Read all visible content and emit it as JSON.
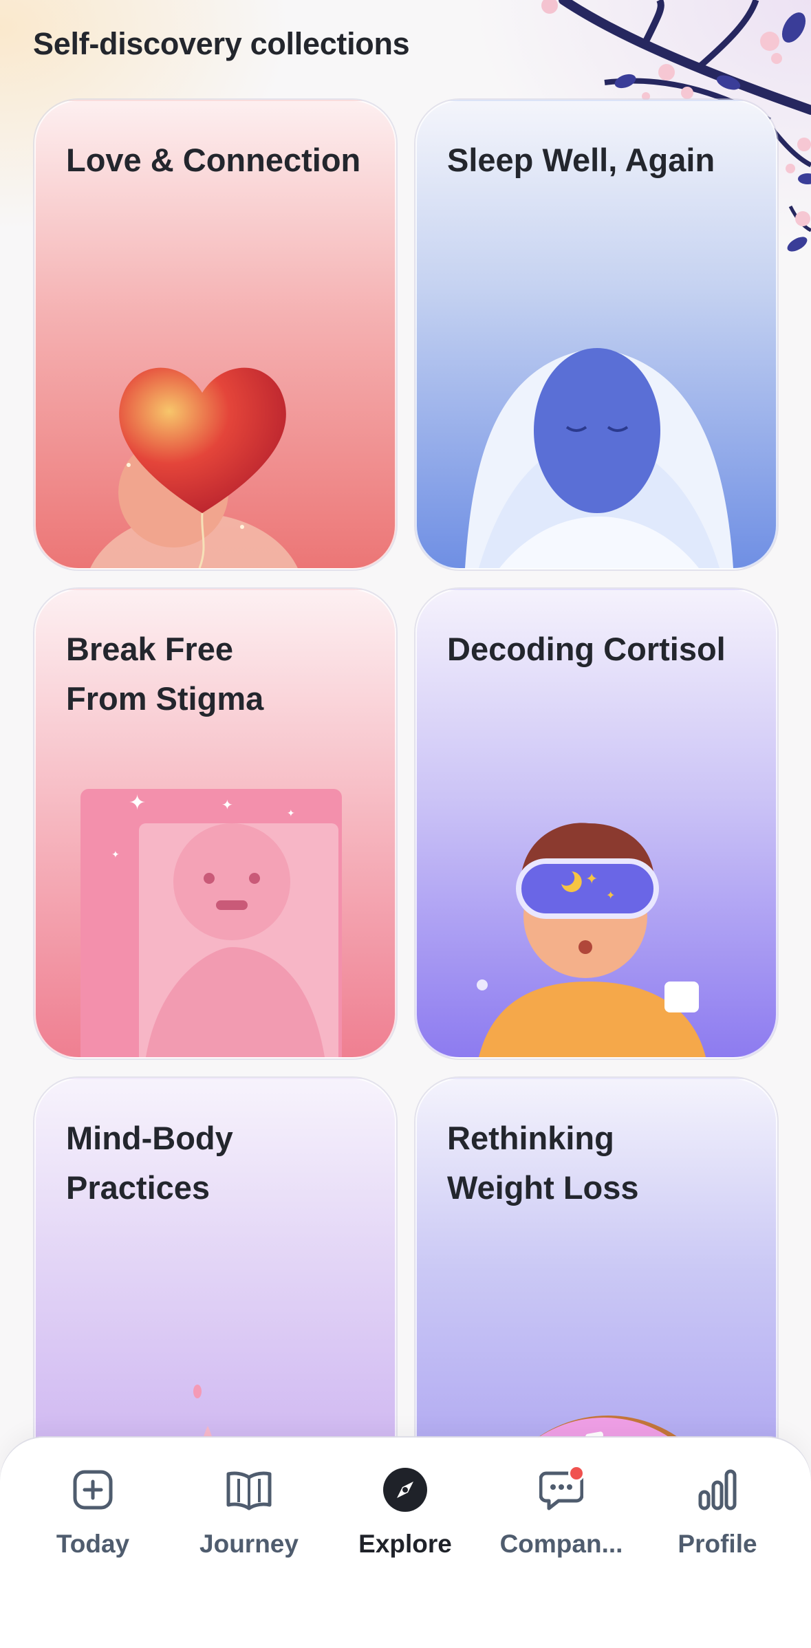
{
  "header": {
    "title": "Self-discovery collections"
  },
  "collections": [
    {
      "title": "Love & Connection"
    },
    {
      "title": "Sleep Well, Again"
    },
    {
      "title_line1": "Break Free",
      "title_line2": "From Stigma"
    },
    {
      "title": "Decoding Cortisol"
    },
    {
      "title_line1": "Mind-Body",
      "title_line2": "Practices"
    },
    {
      "title_line1": "Rethinking",
      "title_line2": "Weight Loss"
    }
  ],
  "tabs": [
    {
      "label": "Today",
      "icon": "plus-square-icon",
      "active": false
    },
    {
      "label": "Journey",
      "icon": "open-book-icon",
      "active": false
    },
    {
      "label": "Explore",
      "icon": "compass-icon",
      "active": true
    },
    {
      "label": "Compan...",
      "icon": "chat-bubble-icon",
      "active": false,
      "badge": true
    },
    {
      "label": "Profile",
      "icon": "bar-chart-icon",
      "active": false
    }
  ],
  "colors": {
    "active_tab": "#1f2229",
    "inactive_tab": "#4f5c6e",
    "badge": "#f0524f"
  }
}
